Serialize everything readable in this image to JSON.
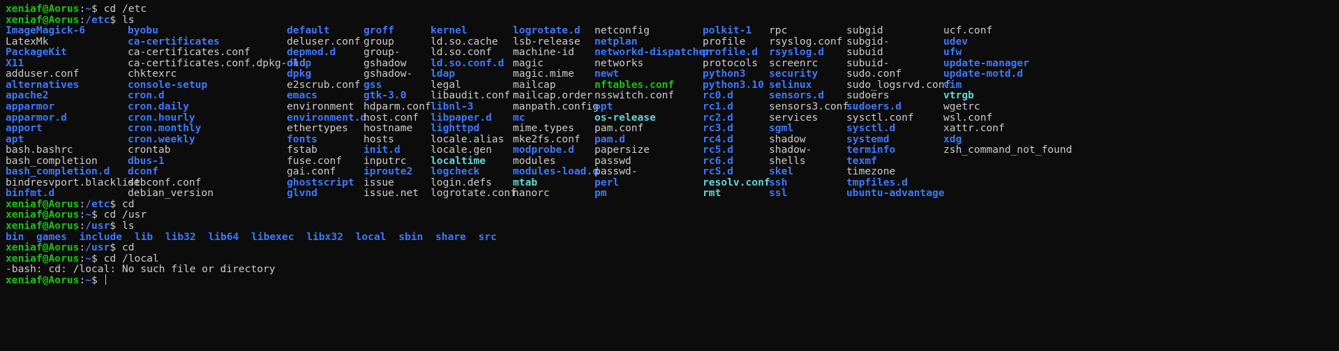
{
  "prompt": {
    "user_host": "xeniaf@Aorus",
    "symbol": "$ "
  },
  "lines": [
    {
      "row": 0,
      "path": "~",
      "command": "cd /etc"
    },
    {
      "row": 1,
      "path": "/etc",
      "command": "ls"
    },
    {
      "row": 18,
      "path": "/etc",
      "command": "cd"
    },
    {
      "row": 19,
      "path": "~",
      "command": "cd /usr"
    },
    {
      "row": 20,
      "path": "/usr",
      "command": "ls"
    },
    {
      "row": 22,
      "path": "/usr",
      "command": "cd"
    },
    {
      "row": 23,
      "path": "~",
      "command": "cd /local"
    },
    {
      "row": 25,
      "path": "~",
      "command": ""
    }
  ],
  "error_line": {
    "row": 24,
    "text": "-bash: cd: /local: No such file or directory"
  },
  "etc_listing": [
    [
      "ImageMagick-6",
      "dir"
    ],
    [
      "LatexMk",
      "file"
    ],
    [
      "PackageKit",
      "dir"
    ],
    [
      "X11",
      "dir"
    ],
    [
      "adduser.conf",
      "file"
    ],
    [
      "alternatives",
      "dir"
    ],
    [
      "apache2",
      "dir"
    ],
    [
      "apparmor",
      "dir"
    ],
    [
      "apparmor.d",
      "dir"
    ],
    [
      "apport",
      "dir"
    ],
    [
      "apt",
      "dir"
    ],
    [
      "bash.bashrc",
      "file"
    ],
    [
      "bash_completion",
      "file"
    ],
    [
      "bash_completion.d",
      "dir"
    ],
    [
      "bindresvport.blacklist",
      "file"
    ],
    [
      "binfmt.d",
      "dir"
    ],
    [
      "byobu",
      "dir"
    ],
    [
      "ca-certificates",
      "dir"
    ],
    [
      "ca-certificates.conf",
      "file"
    ],
    [
      "ca-certificates.conf.dpkg-old",
      "file"
    ],
    [
      "chktexrc",
      "file"
    ],
    [
      "console-setup",
      "dir"
    ],
    [
      "cron.d",
      "dir"
    ],
    [
      "cron.daily",
      "dir"
    ],
    [
      "cron.hourly",
      "dir"
    ],
    [
      "cron.monthly",
      "dir"
    ],
    [
      "cron.weekly",
      "dir"
    ],
    [
      "crontab",
      "file"
    ],
    [
      "dbus-1",
      "dir"
    ],
    [
      "dconf",
      "dir"
    ],
    [
      "debconf.conf",
      "file"
    ],
    [
      "debian_version",
      "file"
    ],
    [
      "default",
      "dir"
    ],
    [
      "deluser.conf",
      "file"
    ],
    [
      "depmod.d",
      "dir"
    ],
    [
      "dhcp",
      "dir"
    ],
    [
      "dpkg",
      "dir"
    ],
    [
      "e2scrub.conf",
      "file"
    ],
    [
      "emacs",
      "dir"
    ],
    [
      "environment",
      "file"
    ],
    [
      "environment.d",
      "dir"
    ],
    [
      "ethertypes",
      "file"
    ],
    [
      "fonts",
      "dir"
    ],
    [
      "fstab",
      "file"
    ],
    [
      "fuse.conf",
      "file"
    ],
    [
      "gai.conf",
      "file"
    ],
    [
      "ghostscript",
      "dir"
    ],
    [
      "glvnd",
      "dir"
    ],
    [
      "groff",
      "dir"
    ],
    [
      "group",
      "file"
    ],
    [
      "group-",
      "file"
    ],
    [
      "gshadow",
      "file"
    ],
    [
      "gshadow-",
      "file"
    ],
    [
      "gss",
      "dir"
    ],
    [
      "gtk-3.0",
      "dir"
    ],
    [
      "hdparm.conf",
      "file"
    ],
    [
      "host.conf",
      "file"
    ],
    [
      "hostname",
      "file"
    ],
    [
      "hosts",
      "file"
    ],
    [
      "init.d",
      "dir"
    ],
    [
      "inputrc",
      "file"
    ],
    [
      "iproute2",
      "dir"
    ],
    [
      "issue",
      "file"
    ],
    [
      "issue.net",
      "file"
    ],
    [
      "kernel",
      "dir"
    ],
    [
      "ld.so.cache",
      "file"
    ],
    [
      "ld.so.conf",
      "file"
    ],
    [
      "ld.so.conf.d",
      "dir"
    ],
    [
      "ldap",
      "dir"
    ],
    [
      "legal",
      "file"
    ],
    [
      "libaudit.conf",
      "file"
    ],
    [
      "libnl-3",
      "dir"
    ],
    [
      "libpaper.d",
      "dir"
    ],
    [
      "lighttpd",
      "dir"
    ],
    [
      "locale.alias",
      "file"
    ],
    [
      "locale.gen",
      "file"
    ],
    [
      "localtime",
      "link"
    ],
    [
      "logcheck",
      "dir"
    ],
    [
      "login.defs",
      "file"
    ],
    [
      "logrotate.conf",
      "file"
    ],
    [
      "logrotate.d",
      "dir"
    ],
    [
      "lsb-release",
      "file"
    ],
    [
      "machine-id",
      "file"
    ],
    [
      "magic",
      "file"
    ],
    [
      "magic.mime",
      "file"
    ],
    [
      "mailcap",
      "file"
    ],
    [
      "mailcap.order",
      "file"
    ],
    [
      "manpath.config",
      "file"
    ],
    [
      "mc",
      "dir"
    ],
    [
      "mime.types",
      "file"
    ],
    [
      "mke2fs.conf",
      "file"
    ],
    [
      "modprobe.d",
      "dir"
    ],
    [
      "modules",
      "file"
    ],
    [
      "modules-load.d",
      "dir"
    ],
    [
      "mtab",
      "link"
    ],
    [
      "nanorc",
      "file"
    ],
    [
      "netconfig",
      "file"
    ],
    [
      "netplan",
      "dir"
    ],
    [
      "networkd-dispatcher",
      "dir"
    ],
    [
      "networks",
      "file"
    ],
    [
      "newt",
      "dir"
    ],
    [
      "nftables.conf",
      "exec"
    ],
    [
      "nsswitch.conf",
      "file"
    ],
    [
      "opt",
      "dir"
    ],
    [
      "os-release",
      "link"
    ],
    [
      "pam.conf",
      "file"
    ],
    [
      "pam.d",
      "dir"
    ],
    [
      "papersize",
      "file"
    ],
    [
      "passwd",
      "file"
    ],
    [
      "passwd-",
      "file"
    ],
    [
      "perl",
      "dir"
    ],
    [
      "pm",
      "dir"
    ],
    [
      "polkit-1",
      "dir"
    ],
    [
      "profile",
      "file"
    ],
    [
      "profile.d",
      "dir"
    ],
    [
      "protocols",
      "file"
    ],
    [
      "python3",
      "dir"
    ],
    [
      "python3.10",
      "dir"
    ],
    [
      "rc0.d",
      "dir"
    ],
    [
      "rc1.d",
      "dir"
    ],
    [
      "rc2.d",
      "dir"
    ],
    [
      "rc3.d",
      "dir"
    ],
    [
      "rc4.d",
      "dir"
    ],
    [
      "rc5.d",
      "dir"
    ],
    [
      "rc6.d",
      "dir"
    ],
    [
      "rcS.d",
      "dir"
    ],
    [
      "resolv.conf",
      "link"
    ],
    [
      "rmt",
      "link"
    ],
    [
      "rpc",
      "file"
    ],
    [
      "rsyslog.conf",
      "file"
    ],
    [
      "rsyslog.d",
      "dir"
    ],
    [
      "screenrc",
      "file"
    ],
    [
      "security",
      "dir"
    ],
    [
      "selinux",
      "dir"
    ],
    [
      "sensors.d",
      "dir"
    ],
    [
      "sensors3.conf",
      "file"
    ],
    [
      "services",
      "file"
    ],
    [
      "sgml",
      "dir"
    ],
    [
      "shadow",
      "file"
    ],
    [
      "shadow-",
      "file"
    ],
    [
      "shells",
      "file"
    ],
    [
      "skel",
      "dir"
    ],
    [
      "ssh",
      "dir"
    ],
    [
      "ssl",
      "dir"
    ],
    [
      "subgid",
      "file"
    ],
    [
      "subgid-",
      "file"
    ],
    [
      "subuid",
      "file"
    ],
    [
      "subuid-",
      "file"
    ],
    [
      "sudo.conf",
      "file"
    ],
    [
      "sudo_logsrvd.conf",
      "file"
    ],
    [
      "sudoers",
      "file"
    ],
    [
      "sudoers.d",
      "dir"
    ],
    [
      "sysctl.conf",
      "file"
    ],
    [
      "sysctl.d",
      "dir"
    ],
    [
      "systemd",
      "dir"
    ],
    [
      "terminfo",
      "dir"
    ],
    [
      "texmf",
      "dir"
    ],
    [
      "timezone",
      "file"
    ],
    [
      "tmpfiles.d",
      "dir"
    ],
    [
      "ubuntu-advantage",
      "dir"
    ],
    [
      "ucf.conf",
      "file"
    ],
    [
      "udev",
      "dir"
    ],
    [
      "ufw",
      "dir"
    ],
    [
      "update-manager",
      "dir"
    ],
    [
      "update-motd.d",
      "dir"
    ],
    [
      "vim",
      "dir"
    ],
    [
      "vtrgb",
      "link"
    ],
    [
      "wgetrc",
      "file"
    ],
    [
      "wsl.conf",
      "file"
    ],
    [
      "xattr.conf",
      "file"
    ],
    [
      "xdg",
      "dir"
    ],
    [
      "zsh_command_not_found",
      "file"
    ]
  ],
  "usr_listing": [
    [
      "bin",
      "dir"
    ],
    [
      "games",
      "dir"
    ],
    [
      "include",
      "dir"
    ],
    [
      "lib",
      "dir"
    ],
    [
      "lib32",
      "dir"
    ],
    [
      "lib64",
      "dir"
    ],
    [
      "libexec",
      "dir"
    ],
    [
      "libx32",
      "dir"
    ],
    [
      "local",
      "dir"
    ],
    [
      "sbin",
      "dir"
    ],
    [
      "share",
      "dir"
    ],
    [
      "src",
      "dir"
    ]
  ],
  "colors": {
    "background": "#0c0c0c",
    "text": "#cccccc",
    "prompt_user": "#16c60c",
    "prompt_path": "#3b78ff",
    "directory": "#3b78ff",
    "symlink": "#61d6d6",
    "executable": "#16c60c"
  }
}
